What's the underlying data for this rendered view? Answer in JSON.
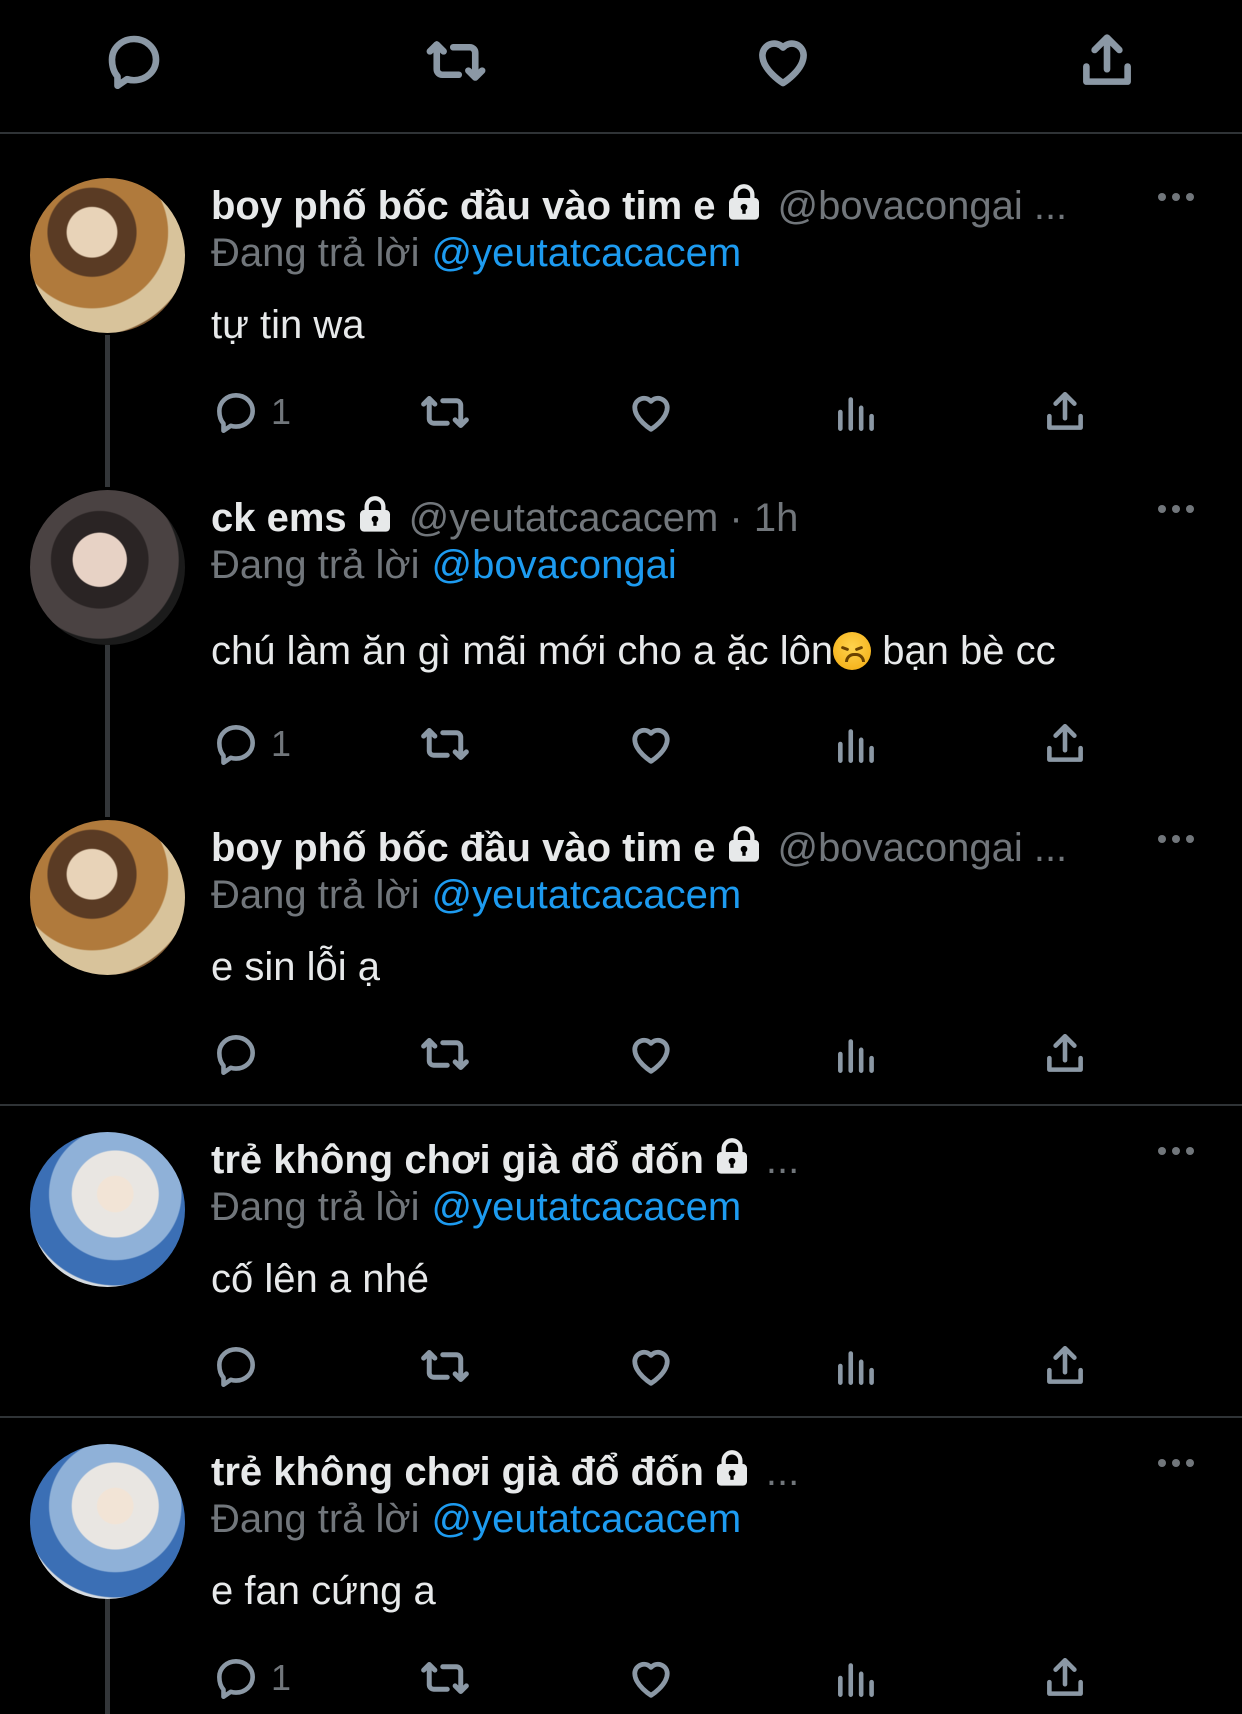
{
  "top_actions": {
    "icons": [
      "reply-icon",
      "retweet-icon",
      "like-icon",
      "share-icon"
    ]
  },
  "tweets": [
    {
      "name": "boy phố bốc đầu vào tim e",
      "handle": "@bovacongai ...",
      "reply_prefix": "Đang trả lời",
      "reply_to": "@yeutatcacacem",
      "text": "tự tin wa",
      "reply_count": "1"
    },
    {
      "name": "ck ems",
      "handle": "@yeutatcacacem · 1h",
      "reply_prefix": "Đang trả lời",
      "reply_to": "@bovacongai",
      "text_before": "chú làm ăn gì mãi mới cho a ặc lôn",
      "text_after": " bạn bè cc",
      "reply_count": "1"
    },
    {
      "name": "boy phố bốc đầu vào tim e",
      "handle": "@bovacongai ...",
      "reply_prefix": "Đang trả lời",
      "reply_to": "@yeutatcacacem",
      "text": "e sin lỗi ạ",
      "reply_count": ""
    },
    {
      "name": "trẻ không chơi già đổ đốn",
      "handle": "...",
      "reply_prefix": "Đang trả lời",
      "reply_to": "@yeutatcacacem",
      "text": "cố lên a nhé",
      "reply_count": ""
    },
    {
      "name": "trẻ không chơi già đổ đốn",
      "handle": "...",
      "reply_prefix": "Đang trả lời",
      "reply_to": "@yeutatcacacem",
      "text": "e fan cứng a",
      "reply_count": "1"
    }
  ],
  "colors": {
    "background": "#000000",
    "text": "#e7e9ea",
    "muted": "#71767b",
    "mention": "#1d9bf0",
    "divider": "#2f3336"
  }
}
